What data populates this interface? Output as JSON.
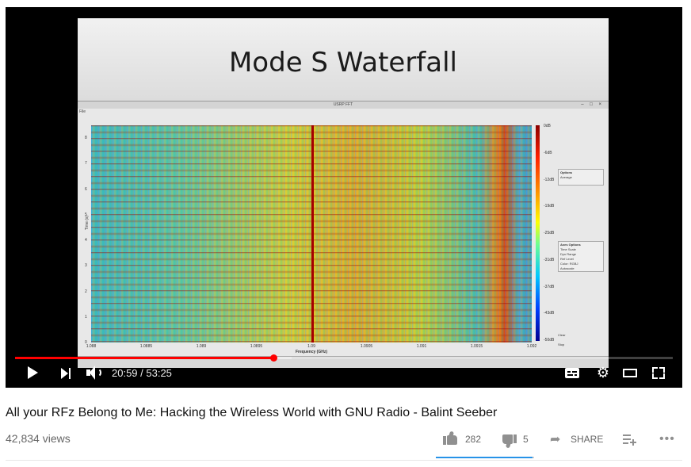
{
  "slide": {
    "title": "Mode S Waterfall",
    "app_title": "USRP FFT",
    "app_menu": "File"
  },
  "chart_data": {
    "type": "heatmap",
    "xlabel": "Frequency (GHz)",
    "ylabel": "Time (s)",
    "x_ticks": [
      "1.088",
      "1.0885",
      "1.089",
      "1.0895",
      "1.09",
      "1.0905",
      "1.091",
      "1.0915",
      "1.092"
    ],
    "y_ticks": [
      "0",
      "1",
      "2",
      "3",
      "4",
      "5",
      "6",
      "7",
      "8"
    ],
    "xlim": [
      1.088,
      1.092
    ],
    "ylim": [
      0,
      8.5
    ],
    "colorbar_labels": [
      "0dB",
      "-6dB",
      "-12dB",
      "-19dB",
      "-25dB",
      "-31dB",
      "-37dB",
      "-43dB",
      "-50dB"
    ],
    "colorbar_range_db": [
      -50,
      0
    ]
  },
  "app_panels": {
    "options_title": "Options",
    "options_row": "Average",
    "axes_title": "Axes Options",
    "axes_rows": [
      "Time Scale",
      "Dyn Range",
      "Ref Level",
      "Color: RGBJ"
    ],
    "autoscale": "Autoscale",
    "clear": "Clear",
    "stop": "Stop"
  },
  "player": {
    "current_time": "20:59",
    "duration": "53:25",
    "time_display": "20:59 / 53:25",
    "progress": 0.393,
    "buffered": 0.42,
    "colors": {
      "progress": "#ff0000",
      "background": "#000000"
    }
  },
  "video": {
    "title": "All your RFz Belong to Me: Hacking the Wireless World with GNU Radio - Balint Seeber",
    "views": "42,834 views",
    "likes": "282",
    "dislikes": "5",
    "share_label": "SHARE",
    "like_ratio": 0.98,
    "accent": "#2793e8"
  }
}
